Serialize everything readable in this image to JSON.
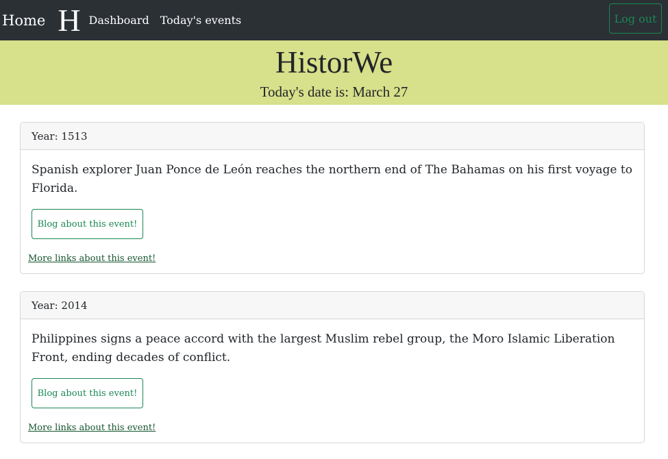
{
  "nav": {
    "home": "Home",
    "logo": "H",
    "dashboard": "Dashboard",
    "todays_events": "Today's events",
    "logout": "Log out"
  },
  "banner": {
    "title": "HistorWe",
    "date": "Today's date is: March 27"
  },
  "events": [
    {
      "year": "Year: 1513",
      "text": "Spanish explorer Juan Ponce de León reaches the northern end of The Bahamas on his first voyage to Florida.",
      "blog_button": "Blog about this event!",
      "more_link": "More links about this event!"
    },
    {
      "year": "Year: 2014",
      "text": "Philippines signs a peace accord with the largest Muslim rebel group, the Moro Islamic Liberation Front, ending decades of conflict.",
      "blog_button": "Blog about this event!",
      "more_link": "More links about this event!"
    }
  ],
  "colors": {
    "navbar_bg": "#2b3035",
    "banner_bg": "#d7e08a",
    "accent_green": "#198754"
  }
}
